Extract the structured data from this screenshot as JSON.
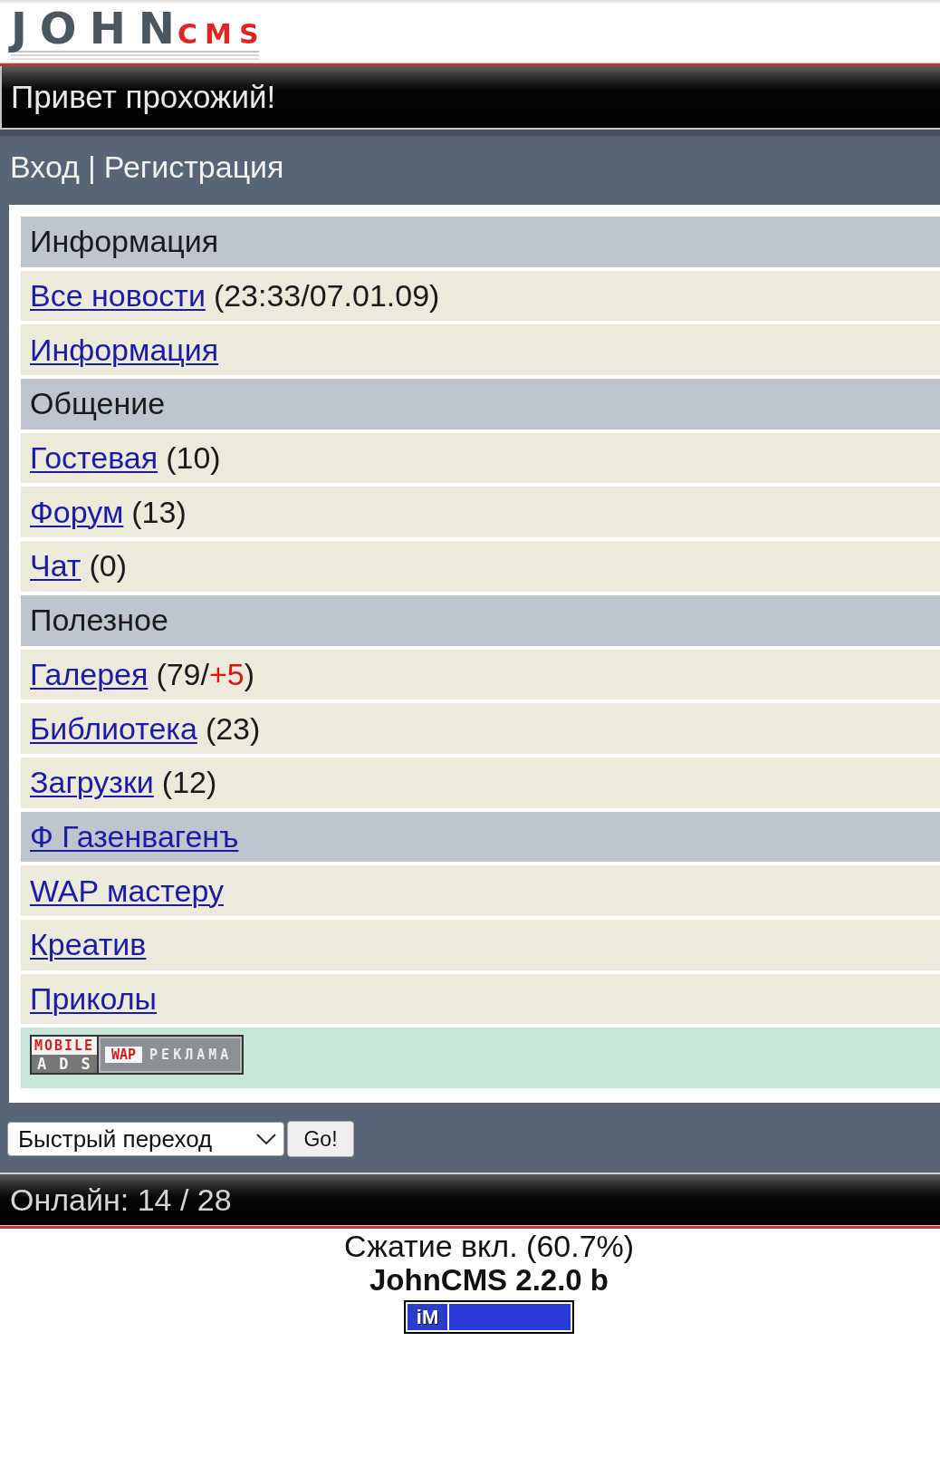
{
  "logo": {
    "name": "JOHN",
    "suffix": "CMS"
  },
  "greeting": "Привет прохожий!",
  "auth": {
    "links": [
      "Вход",
      "Регистрация"
    ],
    "separator": "|"
  },
  "menu": [
    {
      "kind": "heading",
      "title": "Информация"
    },
    {
      "kind": "link",
      "label": "Все новости",
      "note": [
        {
          "text": "(23:33/07.01.09)",
          "highlight": false
        }
      ]
    },
    {
      "kind": "link",
      "label": "Информация"
    },
    {
      "kind": "heading",
      "title": "Общение"
    },
    {
      "kind": "link",
      "label": "Гостевая",
      "note": [
        {
          "text": "(10)",
          "highlight": false
        }
      ]
    },
    {
      "kind": "link",
      "label": "Форум",
      "note": [
        {
          "text": "(13)",
          "highlight": false
        }
      ]
    },
    {
      "kind": "link",
      "label": "Чат",
      "note": [
        {
          "text": "(0)",
          "highlight": false
        }
      ]
    },
    {
      "kind": "heading",
      "title": "Полезное"
    },
    {
      "kind": "link",
      "label": "Галерея",
      "note": [
        {
          "text": "(79/",
          "highlight": false
        },
        {
          "text": "+5",
          "highlight": true
        },
        {
          "text": ")",
          "highlight": false
        }
      ]
    },
    {
      "kind": "link",
      "label": "Библиотека",
      "note": [
        {
          "text": "(23)",
          "highlight": false
        }
      ]
    },
    {
      "kind": "link",
      "label": "Загрузки",
      "note": [
        {
          "text": "(12)",
          "highlight": false
        }
      ]
    },
    {
      "kind": "category",
      "label": "Ф Газенвагенъ"
    },
    {
      "kind": "link",
      "label": "WAP мастеру"
    },
    {
      "kind": "link",
      "label": "Креатив"
    },
    {
      "kind": "link",
      "label": "Приколы"
    },
    {
      "kind": "banner",
      "top": "MOBILE",
      "bottom": "ADS",
      "tag": "WAP",
      "caption": "РЕКЛАМА"
    }
  ],
  "quick_jump": {
    "value": "Быстрый переход",
    "button": "Go!"
  },
  "online": "Онлайн: 14 / 28",
  "footer": {
    "compression": "Сжатие вкл. (60.7%)",
    "version": "JohnCMS 2.2.0 b",
    "counter": "iM"
  }
}
